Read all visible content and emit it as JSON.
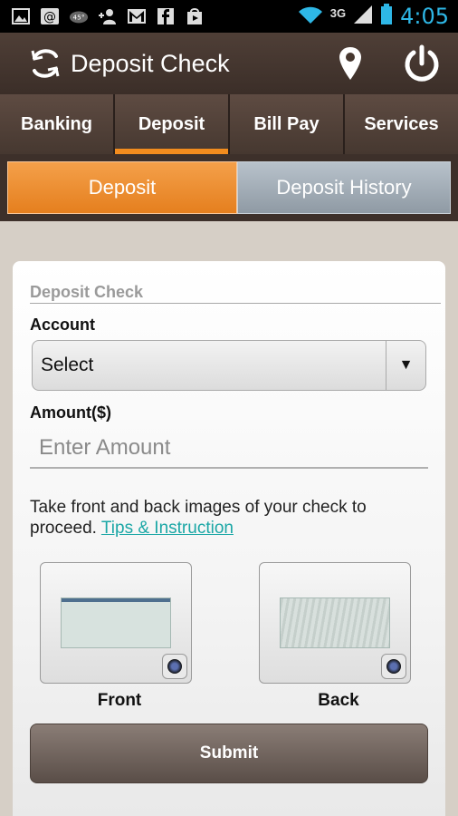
{
  "status_bar": {
    "time": "4:05",
    "network": "3G",
    "weather_temp": "45°",
    "icons": [
      "gallery-icon",
      "email-icon",
      "weather-icon",
      "add-contact-icon",
      "gmail-icon",
      "facebook-icon",
      "play-store-icon",
      "wifi-icon",
      "signal-icon",
      "battery-icon"
    ]
  },
  "header": {
    "title": "Deposit Check",
    "icons": [
      "app-logo-icon",
      "location-pin-icon",
      "power-icon"
    ]
  },
  "main_tabs": [
    {
      "label": "Banking",
      "active": false
    },
    {
      "label": "Deposit",
      "active": true
    },
    {
      "label": "Bill Pay",
      "active": false
    },
    {
      "label": "Services",
      "active": false
    }
  ],
  "sub_tabs": [
    {
      "label": "Deposit",
      "active": true
    },
    {
      "label": "Deposit History",
      "active": false
    }
  ],
  "form": {
    "section_title": "Deposit Check",
    "account_label": "Account",
    "account_value": "Select",
    "amount_label": "Amount($)",
    "amount_placeholder": "Enter Amount",
    "instructions_text": "Take front and back images of your check to proceed.",
    "tips_link": "Tips & Instruction",
    "front_label": "Front",
    "back_label": "Back",
    "submit_label": "Submit"
  },
  "colors": {
    "accent_orange": "#f28c1e",
    "header_brown": "#4f3f37",
    "link_teal": "#1ba7a6",
    "clock_blue": "#2eb7e6"
  }
}
